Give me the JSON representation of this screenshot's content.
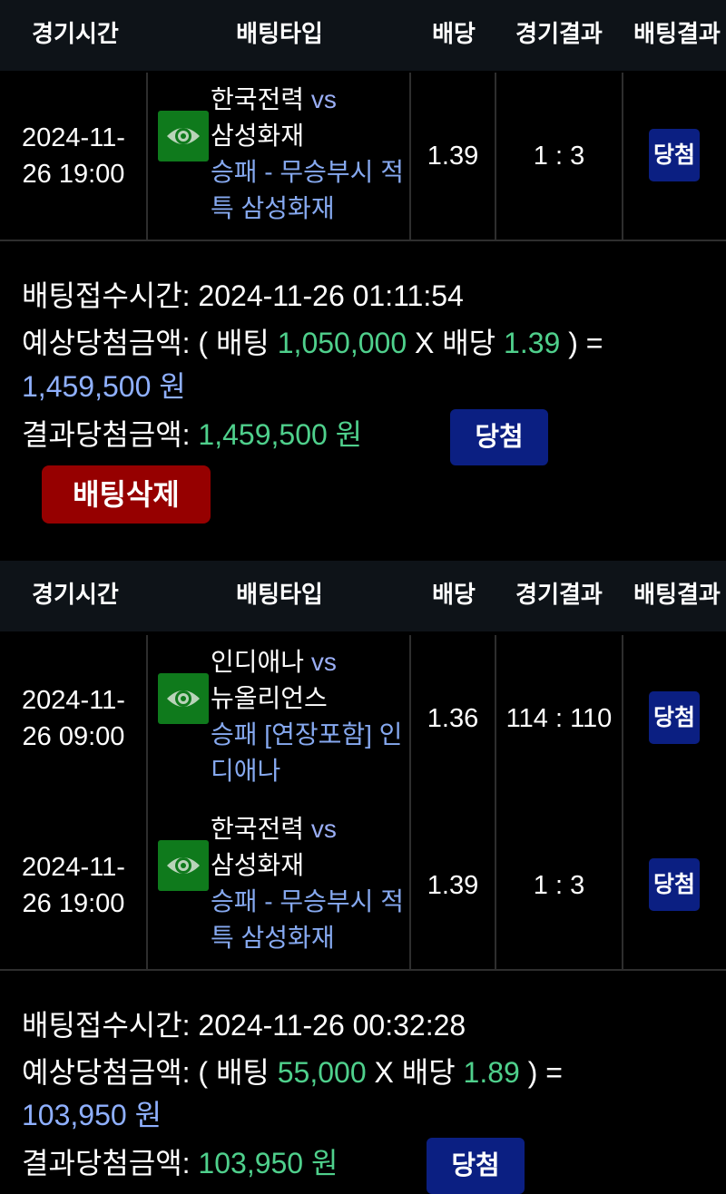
{
  "headers": {
    "time": "경기시간",
    "type": "배팅타입",
    "odds": "배당",
    "score": "경기결과",
    "result": "배팅결과"
  },
  "vs": "vs",
  "bet1": {
    "rows": [
      {
        "date_line1": "2024-11-",
        "date_line2": "26 19:00",
        "team_home": "한국전력",
        "team_away": "삼성화재",
        "bet_type": "승패 - 무승부시 적특 삼성화재",
        "odds": "1.39",
        "score": "1 : 3",
        "result": "당첨",
        "icon": "eye-icon"
      }
    ],
    "receipt_label": "배팅접수시간:",
    "receipt_time": "2024-11-26 01:11:54",
    "expected_label": "예상당첨금액:",
    "open_paren": "( 배팅",
    "stake": "1,050,000",
    "x_odds_label": "X 배당",
    "total_odds": "1.39",
    "close_eq": ") =",
    "expected_amount": "1,459,500 원",
    "result_label": "결과당첨금액:",
    "result_amount": "1,459,500 원",
    "result_button": "당첨",
    "delete_button": "배팅삭제"
  },
  "bet2": {
    "rows": [
      {
        "date_line1": "2024-11-",
        "date_line2": "26 09:00",
        "team_home": "인디애나",
        "team_away": "뉴올리언스",
        "bet_type": "승패 [연장포함] 인디애나",
        "odds": "1.36",
        "score": "114 : 110",
        "result": "당첨",
        "icon": "eye-icon"
      },
      {
        "date_line1": "2024-11-",
        "date_line2": "26 19:00",
        "team_home": "한국전력",
        "team_away": "삼성화재",
        "bet_type": "승패 - 무승부시 적특 삼성화재",
        "odds": "1.39",
        "score": "1 : 3",
        "result": "당첨",
        "icon": "eye-icon"
      }
    ],
    "receipt_label": "배팅접수시간:",
    "receipt_time": "2024-11-26 00:32:28",
    "expected_label": "예상당첨금액:",
    "open_paren": "( 배팅",
    "stake": "55,000",
    "x_odds_label": "X 배당",
    "total_odds": "1.89",
    "close_eq": ") =",
    "expected_amount": "103,950 원",
    "result_label": "결과당첨금액:",
    "result_amount": "103,950 원",
    "result_button": "당첨"
  },
  "colors": {
    "background": "#000000",
    "header_bg": "#0e1318",
    "win_button": "#0b1f82",
    "delete_button": "#960000",
    "green_text": "#4fd08c",
    "blue_text": "#8fb0ff",
    "eye_button": "#0f7a1c"
  }
}
